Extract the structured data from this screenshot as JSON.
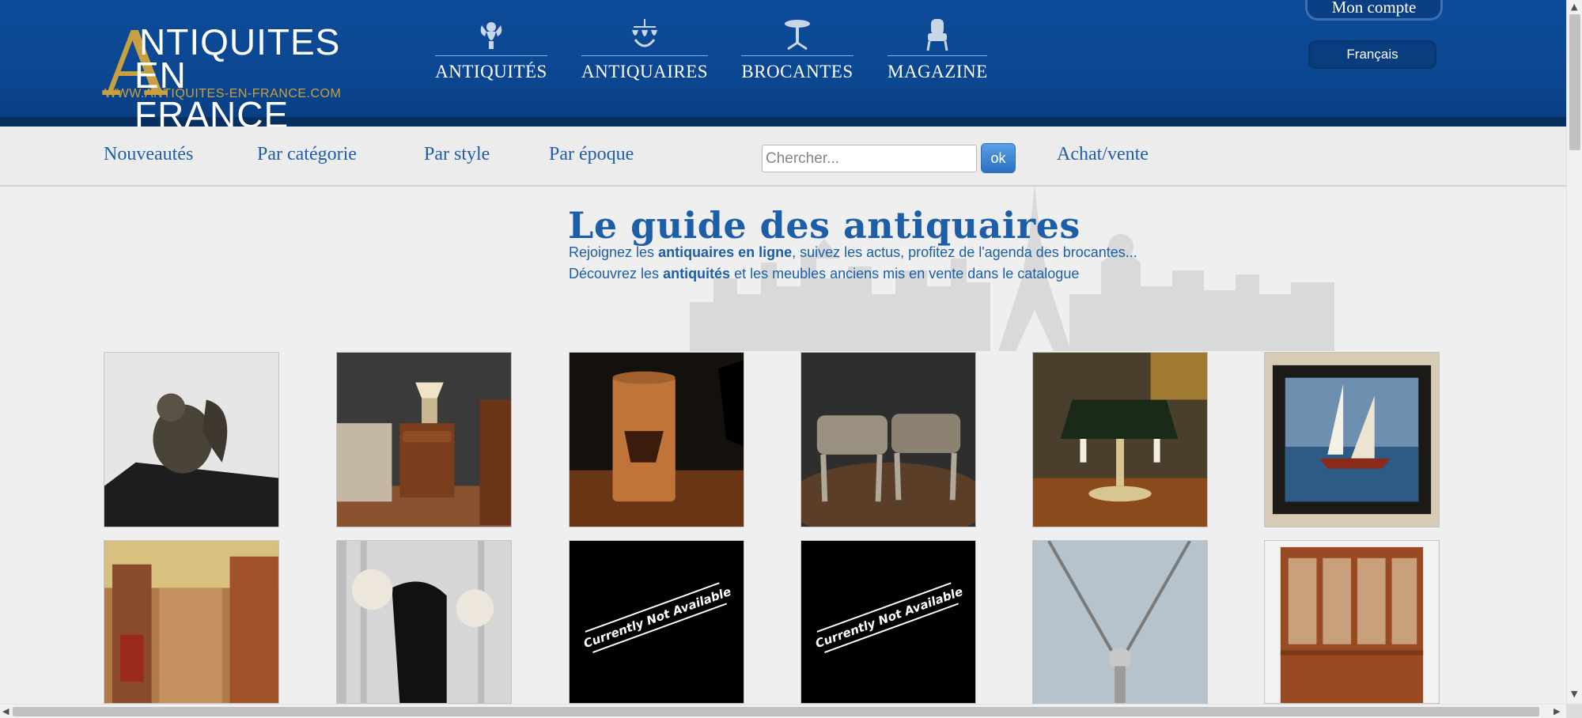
{
  "header": {
    "logo": {
      "big_letter": "A",
      "line1": "NTIQUITES",
      "line2": "EN FRANCE",
      "url": "WWW.ANTIQUITES-EN-FRANCE.COM"
    },
    "main_nav": [
      {
        "label": "ANTIQUITÉS",
        "icon": "cherub-icon"
      },
      {
        "label": "ANTIQUAIRES",
        "icon": "chandelier-icon"
      },
      {
        "label": "BROCANTES",
        "icon": "pedestal-table-icon"
      },
      {
        "label": "MAGAZINE",
        "icon": "armchair-icon"
      }
    ],
    "account_label": "Mon compte",
    "language_label": "Français"
  },
  "subnav": {
    "links": [
      "Nouveautés",
      "Par catégorie",
      "Par style",
      "Par époque"
    ],
    "search_placeholder": "Chercher...",
    "search_button": "ok",
    "achat_vente": "Achat/vente"
  },
  "intro": {
    "title": "Le guide des antiquaires",
    "line1_pre": "Rejoignez les ",
    "line1_bold": "antiquaires en ligne",
    "line1_post": ", suivez les actus, profitez de l'agenda des brocantes...",
    "line2_pre": "Découvrez les ",
    "line2_bold": "antiquités",
    "line2_post": " et les meubles anciens mis en vente dans le catalogue"
  },
  "products": [
    {
      "name": "bronze-squirrel-on-marble"
    },
    {
      "name": "bedside-table-with-lamp"
    },
    {
      "name": "painted-umbrella-stand"
    },
    {
      "name": "pair-of-footstools"
    },
    {
      "name": "bouillotte-lamp"
    },
    {
      "name": "sailboats-painting"
    },
    {
      "name": "orientalist-market-painting"
    },
    {
      "name": "hand-coat-hook"
    },
    {
      "name": "unavailable-image",
      "placeholder_text": "Currently Not Available"
    },
    {
      "name": "unavailable-image",
      "placeholder_text": "Currently Not Available"
    },
    {
      "name": "silver-necklace"
    },
    {
      "name": "wooden-bookcase"
    }
  ],
  "colors": {
    "header_blue": "#0d4c9a",
    "gold": "#c9a040",
    "link_blue": "#1e5fa8"
  }
}
